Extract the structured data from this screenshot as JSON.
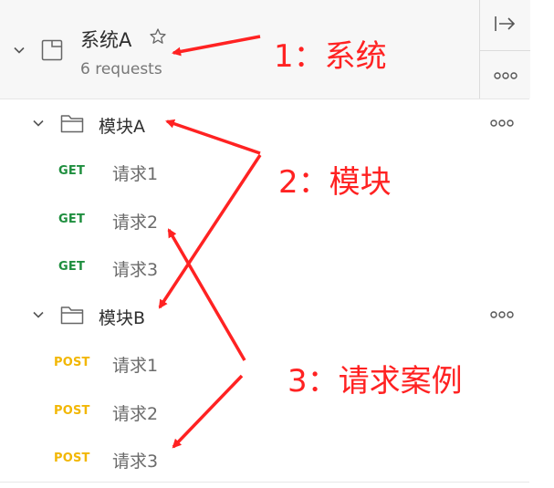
{
  "collection": {
    "name": "系统A",
    "count": "6 requests"
  },
  "folders": [
    {
      "name": "模块A",
      "requests": [
        {
          "method": "GET",
          "name": "请求1"
        },
        {
          "method": "GET",
          "name": "请求2"
        },
        {
          "method": "GET",
          "name": "请求3"
        }
      ]
    },
    {
      "name": "模块B",
      "requests": [
        {
          "method": "POST",
          "name": "请求1"
        },
        {
          "method": "POST",
          "name": "请求2"
        },
        {
          "method": "POST",
          "name": "请求3"
        }
      ]
    }
  ],
  "annotations": {
    "system": "1：系统",
    "module": "2：模块",
    "cases": "3：请求案例"
  },
  "colors": {
    "get": "#1e8e3e",
    "post": "#f2b705",
    "annotation": "#ff2222"
  },
  "icons": [
    "chevron-down-icon",
    "collection-icon",
    "star-icon",
    "folder-icon",
    "collapse-sidebar-icon",
    "more-icon"
  ]
}
